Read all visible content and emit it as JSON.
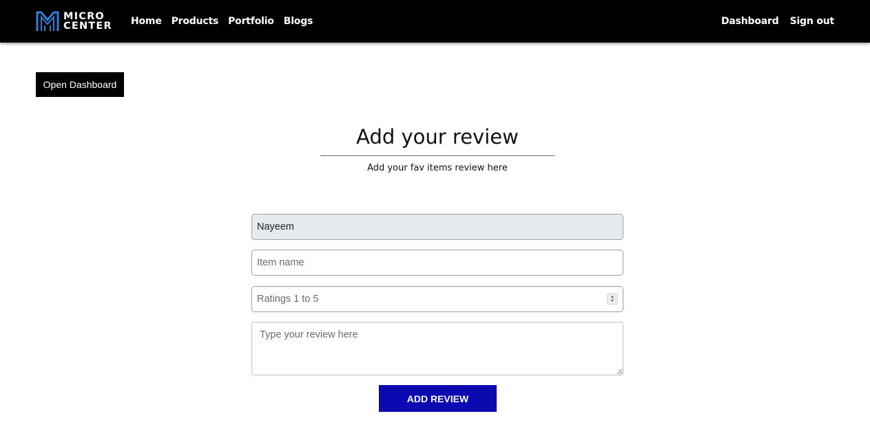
{
  "brand": {
    "line1": "MICRO",
    "line2": "CENTER",
    "accent_color": "#2f80d6"
  },
  "nav": {
    "left": [
      {
        "label": "Home"
      },
      {
        "label": "Products"
      },
      {
        "label": "Portfolio"
      },
      {
        "label": "Blogs"
      }
    ],
    "right": [
      {
        "label": "Dashboard"
      },
      {
        "label": "Sign out"
      }
    ]
  },
  "open_dashboard_label": "Open Dashboard",
  "form": {
    "title": "Add your review",
    "subtitle": "Add your fav items review here",
    "name_value": "Nayeem",
    "item_placeholder": "Item name",
    "rating_placeholder": "Ratings 1 to 5",
    "review_placeholder": "Type your review here",
    "submit_label": "ADD REVIEW",
    "submit_color": "#0a0ab0"
  }
}
